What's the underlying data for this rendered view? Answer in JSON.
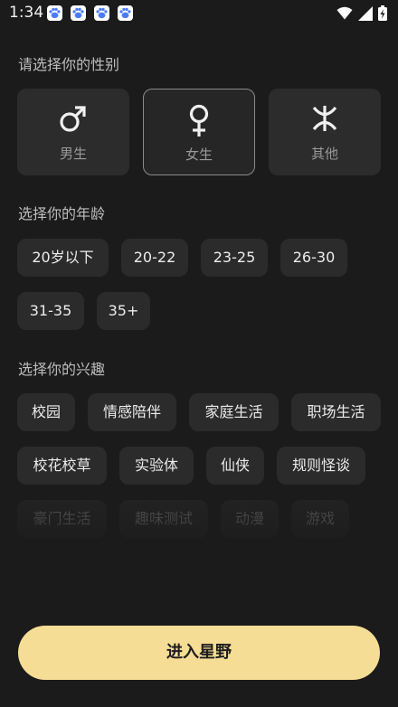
{
  "status_bar": {
    "time": "1:34",
    "notification_icons": [
      "paw-icon",
      "paw-icon",
      "paw-icon",
      "paw-icon"
    ],
    "system_icons": [
      "wifi-icon",
      "cellular-signal-icon",
      "battery-charging-icon"
    ],
    "notification_color": "#4a7cf6"
  },
  "gender": {
    "title": "请选择你的性别",
    "options": [
      {
        "label": "男生",
        "icon": "male-symbol-icon",
        "selected": false
      },
      {
        "label": "女生",
        "icon": "female-symbol-icon",
        "selected": true
      },
      {
        "label": "其他",
        "icon": "other-gender-symbol-icon",
        "selected": false
      }
    ]
  },
  "age": {
    "title": "选择你的年龄",
    "options": [
      "20岁以下",
      "20-22",
      "23-25",
      "26-30",
      "31-35",
      "35+"
    ]
  },
  "interests": {
    "title": "选择你的兴趣",
    "options": [
      "校园",
      "情感陪伴",
      "家庭生活",
      "职场生活",
      "校花校草",
      "实验体",
      "仙侠",
      "规则怪谈",
      "豪门生活",
      "趣味测试",
      "动漫",
      "游戏"
    ]
  },
  "enter_button": {
    "label": "进入星野",
    "color": "#f6dd95"
  },
  "colors": {
    "background": "#1b1b1b",
    "card": "#2c2c2c",
    "chip": "#2b2b2b",
    "accent": "#f6dd95"
  }
}
